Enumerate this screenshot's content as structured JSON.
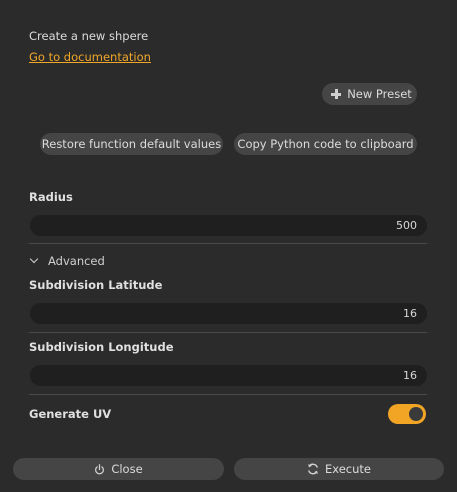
{
  "header": {
    "description": "Create a new shpere",
    "doc_link": "Go to documentation"
  },
  "toolbar": {
    "new_preset_label": "New Preset",
    "restore_label": "Restore function default values",
    "copy_label": "Copy Python code to clipboard"
  },
  "fields": {
    "radius": {
      "label": "Radius",
      "value": "500"
    },
    "advanced_label": "Advanced",
    "subdivision_latitude": {
      "label": "Subdivision Latitude",
      "value": "16"
    },
    "subdivision_longitude": {
      "label": "Subdivision Longitude",
      "value": "16"
    },
    "generate_uv": {
      "label": "Generate UV",
      "enabled": true
    }
  },
  "footer": {
    "close_label": "Close",
    "execute_label": "Execute"
  },
  "colors": {
    "background": "#2b2b2b",
    "accent": "#f2a525",
    "button": "#454545",
    "input": "#1f1f1f"
  },
  "icons": {
    "new_preset": "plus-icon",
    "advanced": "chevron-down-icon",
    "close": "power-icon",
    "execute": "refresh-icon"
  }
}
